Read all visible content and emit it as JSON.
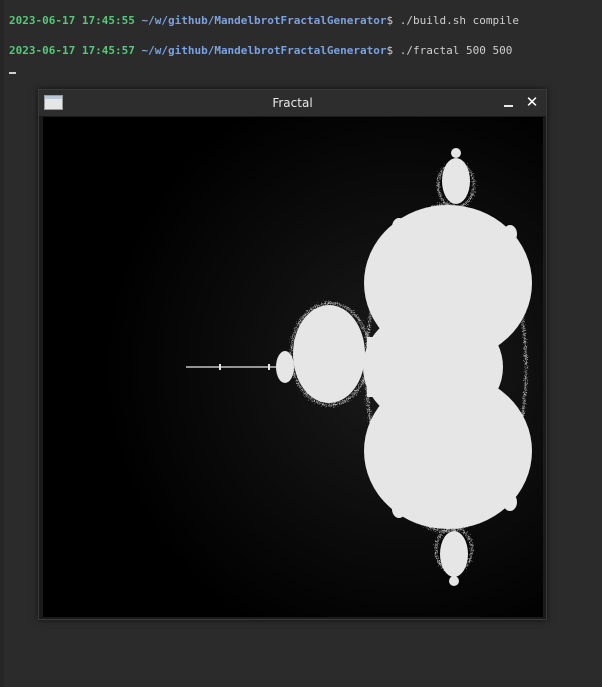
{
  "terminal": {
    "line1": {
      "timestamp": "2023-06-17 17:45:55",
      "path": "~/w/github/MandelbrotFractalGenerator",
      "prompt_symbol": "$",
      "command": " ./build.sh compile"
    },
    "line2": {
      "timestamp": "2023-06-17 17:45:57",
      "path": "~/w/github/MandelbrotFractalGenerator",
      "prompt_symbol": "$",
      "command": " ./fractal 500 500"
    }
  },
  "window": {
    "title": "Fractal",
    "close_glyph": "✕",
    "icons": {
      "app": "window-app-icon",
      "minimize": "minimize-icon",
      "close": "close-icon"
    }
  },
  "colors": {
    "background": "#2b2b2b",
    "timestamp": "#56c878",
    "path": "#7aa2e0",
    "fractal_fill": "#e6e6e6"
  }
}
